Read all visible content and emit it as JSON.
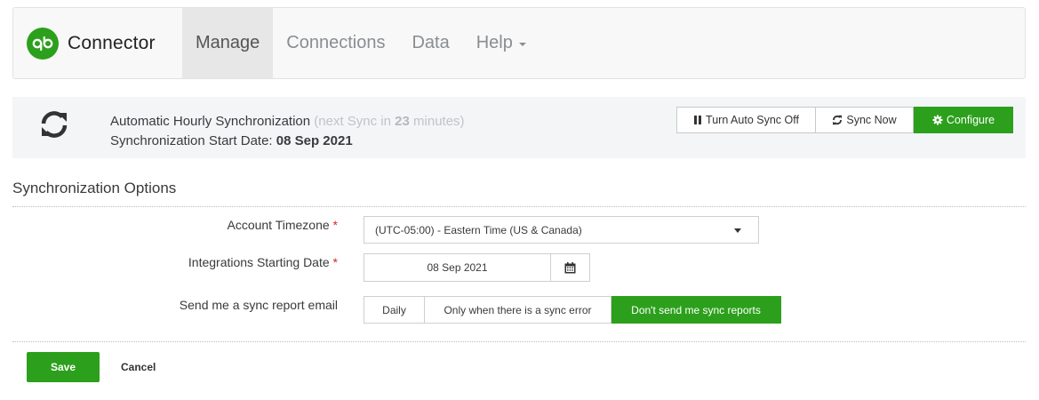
{
  "brand": {
    "name": "Connector",
    "logo_icon": "quickbooks-logo-icon"
  },
  "nav": {
    "manage": "Manage",
    "connections": "Connections",
    "data": "Data",
    "help": "Help"
  },
  "sync": {
    "title": "Automatic Hourly Synchronization",
    "next_prefix": "(next Sync in",
    "next_minutes": "23",
    "next_suffix": "minutes)",
    "start_label": "Synchronization Start Date:",
    "start_value": "08 Sep 2021",
    "buttons": {
      "auto_off": "Turn Auto Sync Off",
      "sync_now": "Sync Now",
      "configure": "Configure"
    }
  },
  "options": {
    "title": "Synchronization Options",
    "timezone_label": "Account Timezone",
    "timezone_value": "(UTC-05:00) -  Eastern Time (US & Canada)",
    "start_date_label": "Integrations Starting Date",
    "start_date_value": "08 Sep 2021",
    "report_label": "Send me a sync report email",
    "report_options": [
      "Daily",
      "Only when there is a sync error",
      "Don't send me sync reports"
    ],
    "report_selected": "Don't send me sync reports",
    "required_mark": "*"
  },
  "footer": {
    "save": "Save",
    "cancel": "Cancel"
  },
  "colors": {
    "accent": "#2ca01c",
    "required": "#d52b1e"
  }
}
